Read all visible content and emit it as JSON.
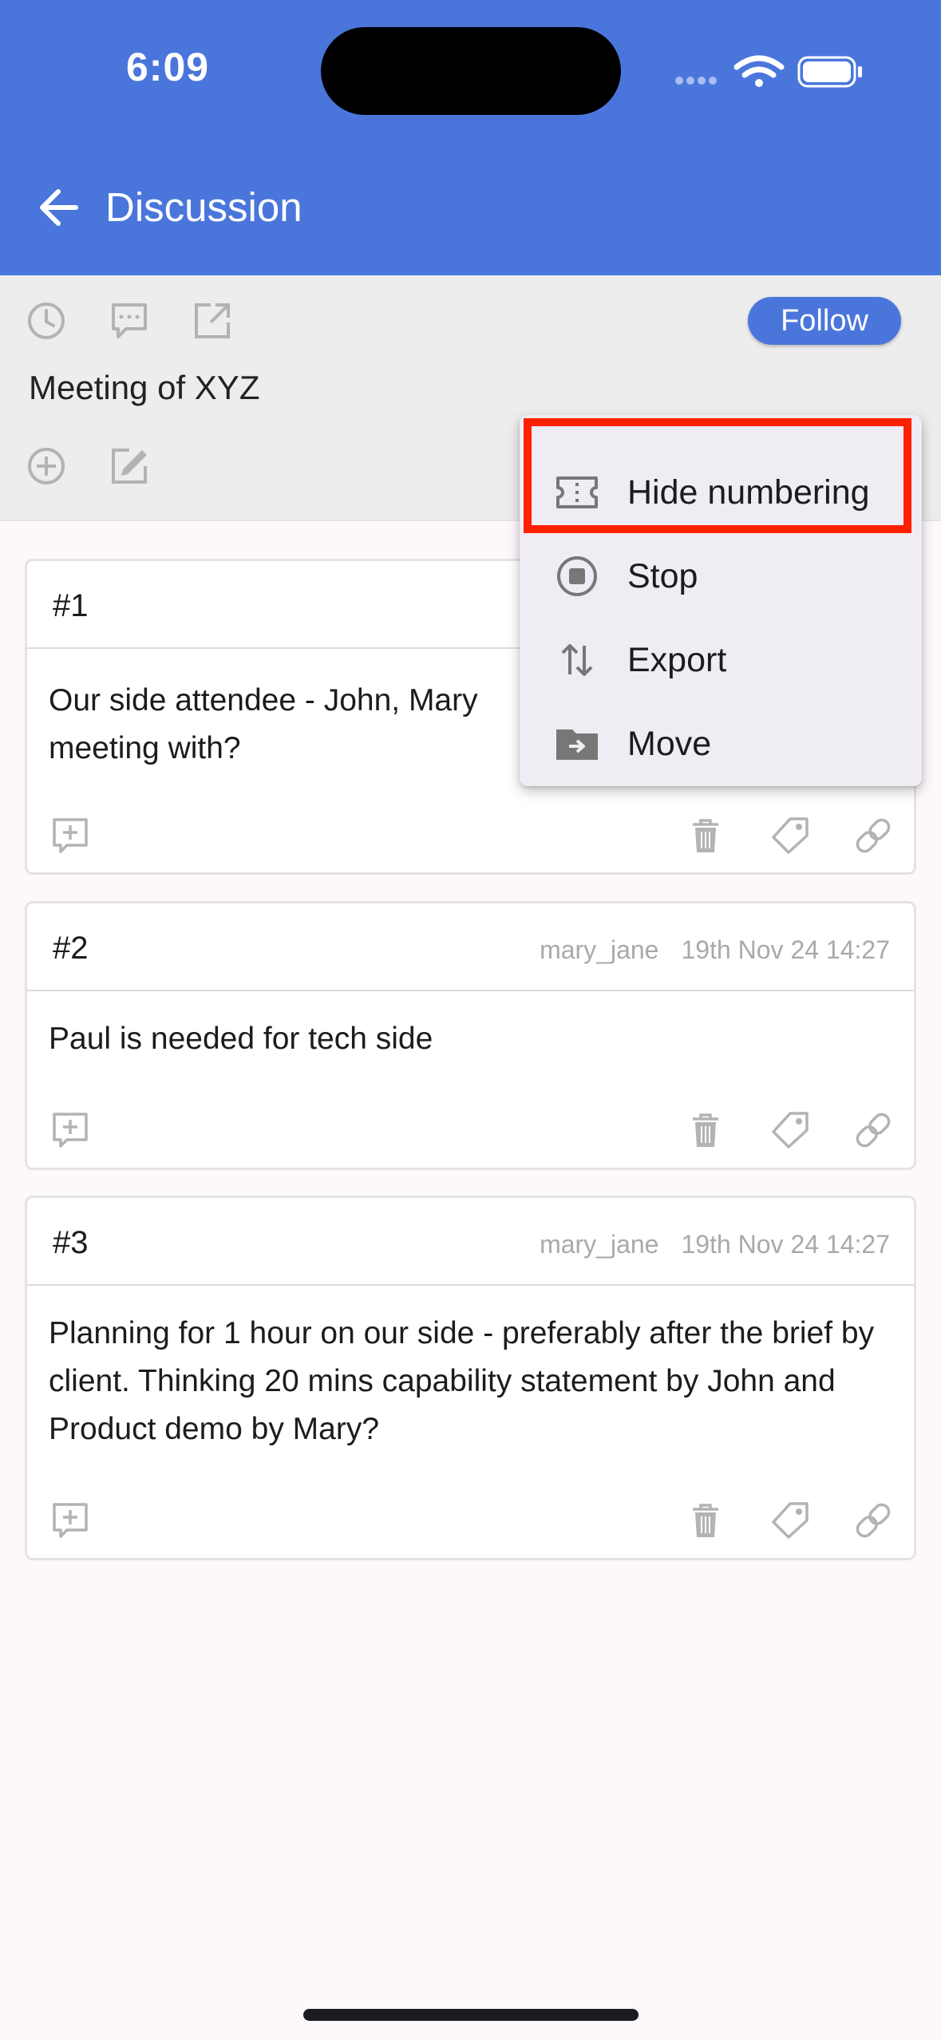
{
  "status_bar": {
    "time": "6:09"
  },
  "app_bar": {
    "title": "Discussion",
    "color": "#4a76dc"
  },
  "toolbar": {
    "follow_label": "Follow",
    "topic_title": "Meeting of XYZ",
    "icons": [
      "clock-icon",
      "comment-icon",
      "open-external-icon",
      "add-circle-icon",
      "edit-icon"
    ]
  },
  "posts": [
    {
      "number": "#1",
      "author": "",
      "timestamp": "",
      "body": "Our side attendee - John, Mary\nmeeting with?"
    },
    {
      "number": "#2",
      "author": "mary_jane",
      "timestamp": "19th Nov 24 14:27",
      "body": "Paul is needed for tech side"
    },
    {
      "number": "#3",
      "author": "mary_jane",
      "timestamp": "19th Nov 24 14:27",
      "body": "Planning for 1 hour on our side - preferably after the brief by client. Thinking 20 mins capability statement by John and Product demo by Mary?"
    }
  ],
  "menu": {
    "items": [
      {
        "label": "Hide numbering",
        "icon": "numbering-ticket-icon"
      },
      {
        "label": "Stop",
        "icon": "stop-circle-icon"
      },
      {
        "label": "Export",
        "icon": "import-export-icon"
      },
      {
        "label": "Move",
        "icon": "move-folder-icon"
      }
    ],
    "highlight_color": "#ff2000"
  }
}
